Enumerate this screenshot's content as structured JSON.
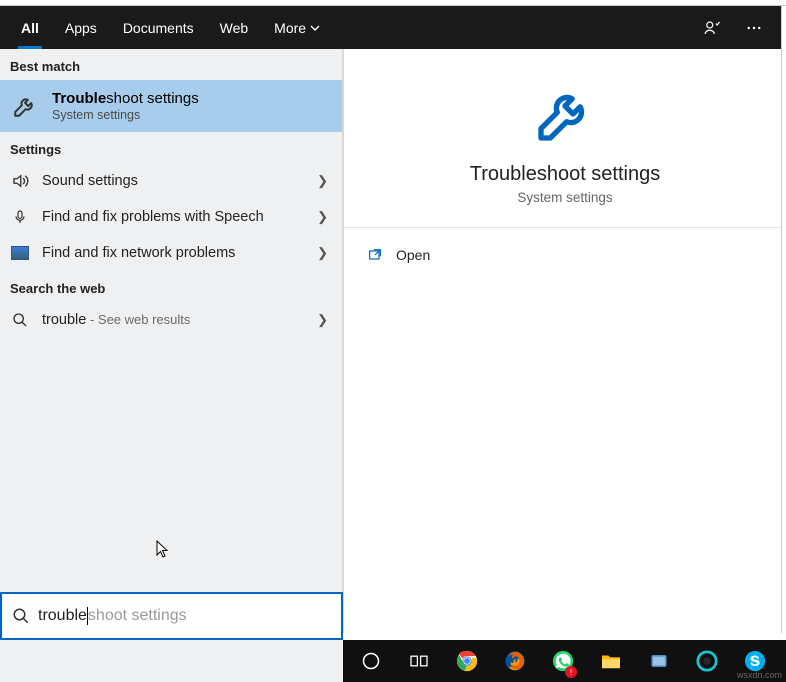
{
  "tabs": {
    "all": "All",
    "apps": "Apps",
    "documents": "Documents",
    "web": "Web",
    "more": "More"
  },
  "sections": {
    "best_match": "Best match",
    "settings": "Settings",
    "search_web": "Search the web"
  },
  "best_match": {
    "title_bold": "Trouble",
    "title_rest": "shoot settings",
    "subtitle": "System settings"
  },
  "settings_items": [
    {
      "label": "Sound settings",
      "icon": "sound"
    },
    {
      "label": "Find and fix problems with Speech",
      "icon": "mic"
    },
    {
      "label": "Find and fix network problems",
      "icon": "net"
    }
  ],
  "web_item": {
    "term": "trouble",
    "suffix": " - See web results"
  },
  "detail": {
    "title": "Troubleshoot settings",
    "subtitle": "System settings",
    "open": "Open"
  },
  "search": {
    "typed": "trouble",
    "ghost": "shoot settings"
  },
  "watermark": "wsxdn.com"
}
